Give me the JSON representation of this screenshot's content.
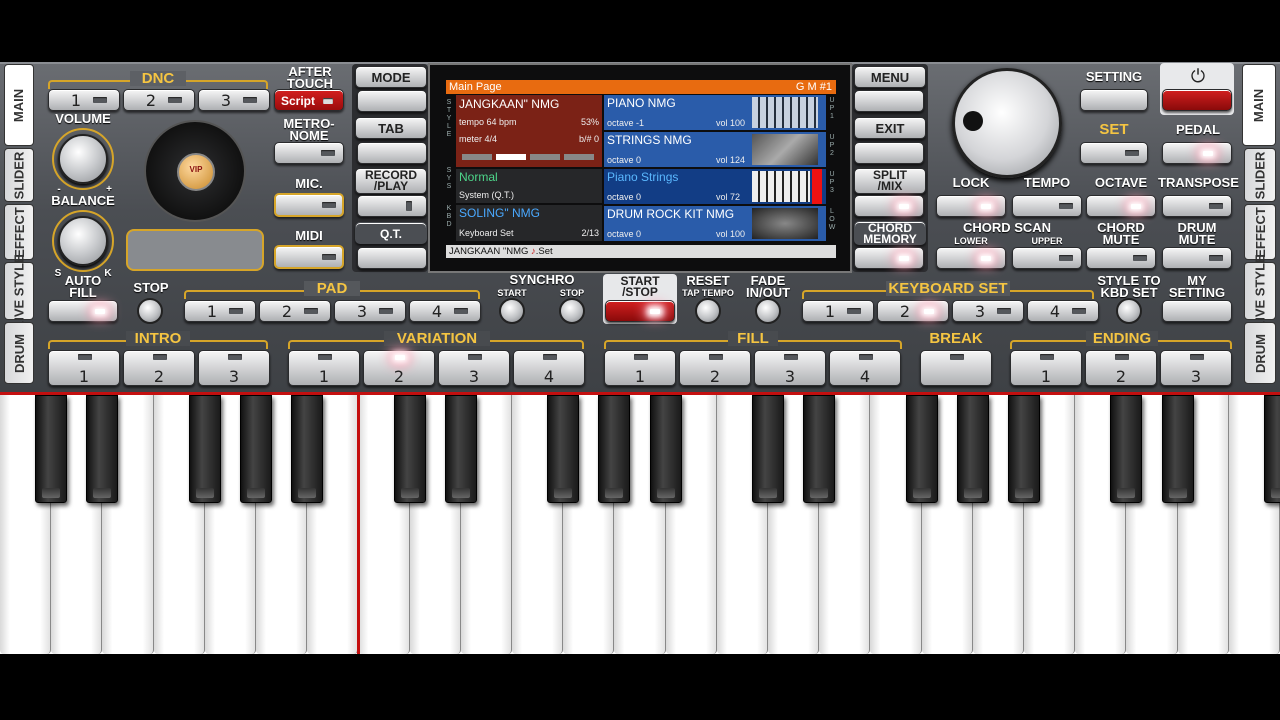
{
  "left_panel": {
    "dnc_label": "DNC",
    "dnc_buttons": [
      "1",
      "2",
      "3"
    ],
    "aftertouch_label": "AFTER\nTOUCH",
    "script_label": "Script",
    "volume_label": "VOLUME",
    "volume_min": "-",
    "volume_max": "+",
    "balance_label": "BALANCE",
    "balance_s": "S",
    "balance_k": "K",
    "logo_text": "VIP",
    "metronome_label": "METRO-\nNOME",
    "mic_label": "MIC.",
    "midi_label": "MIDI",
    "mode_label": "MODE",
    "tab_label": "TAB",
    "record_label": "RECORD\n/PLAY",
    "qt_label": "Q.T."
  },
  "side_tabs_left": [
    "MAIN",
    "SLIDER",
    "EFFECT",
    "LIVE STYLE",
    "DRUM"
  ],
  "side_tabs_right": [
    "MAIN",
    "SLIDER",
    "EFFECT",
    "LIVE STYLE",
    "DRUM"
  ],
  "display": {
    "header": "Main Page",
    "header_right": "G M #1",
    "style_name": "JANGKAAN\" NMG",
    "style_tempo": "tempo 64 bpm",
    "style_percent": "53%",
    "style_meter": "meter 4/4",
    "style_key": "b/# 0",
    "sys_name": "Normal",
    "sys_sub": "System (Q.T.)",
    "kbd_name": "SOLING\" NMG",
    "kbd_sub": "Keyboard Set",
    "kbd_count": "2/13",
    "footer": "JANGKAAN \"NMG",
    "footer_suffix": ".Set",
    "side_style": "S T Y L E",
    "side_sys": "S Y S",
    "side_kbd": "K B D",
    "voices": [
      {
        "name": "PIANO NMG",
        "octave": "octave -1",
        "vol": "vol 100",
        "tag": "U P 1"
      },
      {
        "name": "STRINGS NMG",
        "octave": "octave  0",
        "vol": "vol 124",
        "tag": "U P 2"
      },
      {
        "name": "Piano Strings",
        "octave": "octave  0",
        "vol": "vol 72",
        "tag": "U P 3"
      },
      {
        "name": "DRUM ROCK KIT NMG",
        "octave": "octave  0",
        "vol": "vol 100",
        "tag": "L O W"
      }
    ]
  },
  "right_panel": {
    "menu_label": "MENU",
    "exit_label": "EXIT",
    "split_label": "SPLIT\n/MIX",
    "chord_memory_label": "CHORD\nMEMORY",
    "setting_label": "SETTING",
    "set_label": "SET",
    "pedal_label": "PEDAL",
    "lock_label": "LOCK",
    "tempo_label": "TEMPO",
    "octave_label": "OCTAVE",
    "transpose_label": "TRANSPOSE",
    "chord_scan_label": "CHORD SCAN",
    "lower_label": "LOWER",
    "upper_label": "UPPER",
    "chord_mute_label": "CHORD\nMUTE",
    "drum_mute_label": "DRUM\nMUTE"
  },
  "controls": {
    "auto_fill": "AUTO\nFILL",
    "stop": "STOP",
    "pad": "PAD",
    "pad_buttons": [
      "1",
      "2",
      "3",
      "4"
    ],
    "synchro": "SYNCHRO",
    "synchro_start": "START",
    "synchro_stop": "STOP",
    "start_stop": "START\n/STOP",
    "reset": "RESET",
    "tap_tempo": "TAP TEMPO",
    "fade": "FADE\nIN/OUT",
    "keyboard_set": "KEYBOARD SET",
    "kbd_buttons": [
      "1",
      "2",
      "3",
      "4"
    ],
    "style_to_kbd": "STYLE TO\nKBD SET",
    "my_setting": "MY\nSETTING",
    "intro": "INTRO",
    "intro_buttons": [
      "1",
      "2",
      "3"
    ],
    "variation": "VARIATION",
    "variation_buttons": [
      "1",
      "2",
      "3",
      "4"
    ],
    "fill": "FILL",
    "fill_buttons": [
      "1",
      "2",
      "3",
      "4"
    ],
    "break": "BREAK",
    "ending": "ENDING",
    "ending_buttons": [
      "1",
      "2",
      "3"
    ]
  },
  "colors": {
    "accent_gold": "#f5c542",
    "display_orange": "#e86b10",
    "active_red": "#c41010"
  }
}
